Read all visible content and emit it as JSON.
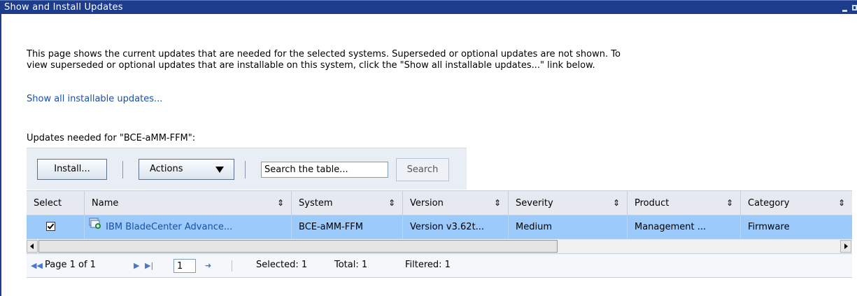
{
  "window": {
    "title": "Show and Install Updates"
  },
  "description": {
    "line1": "This page shows the current updates that are needed for the selected systems. Superseded or optional updates are not shown. To",
    "line2": "view superseded or optional updates that are installable on this system, click the \"Show all installable updates...\" link below."
  },
  "link_show_all": "Show all installable updates...",
  "updates_heading": "Updates needed for \"BCE-aMM-FFM\":",
  "toolbar": {
    "install_label": "Install...",
    "actions_label": "Actions",
    "search_value": "Search the table...",
    "search_button": "Search"
  },
  "table": {
    "columns": [
      "Select",
      "Name",
      "System",
      "Version",
      "Severity",
      "Product",
      "Category"
    ],
    "rows": [
      {
        "selected": true,
        "name": "IBM BladeCenter Advance...",
        "system": "BCE-aMM-FFM",
        "version": "Version v3.62t...",
        "severity": "Medium",
        "product": "Management ...",
        "category": "Firmware"
      }
    ]
  },
  "pager": {
    "page_label": "Page 1 of 1",
    "page_value": "1",
    "selected": "Selected: 1",
    "total": "Total: 1",
    "filtered": "Filtered: 1"
  }
}
